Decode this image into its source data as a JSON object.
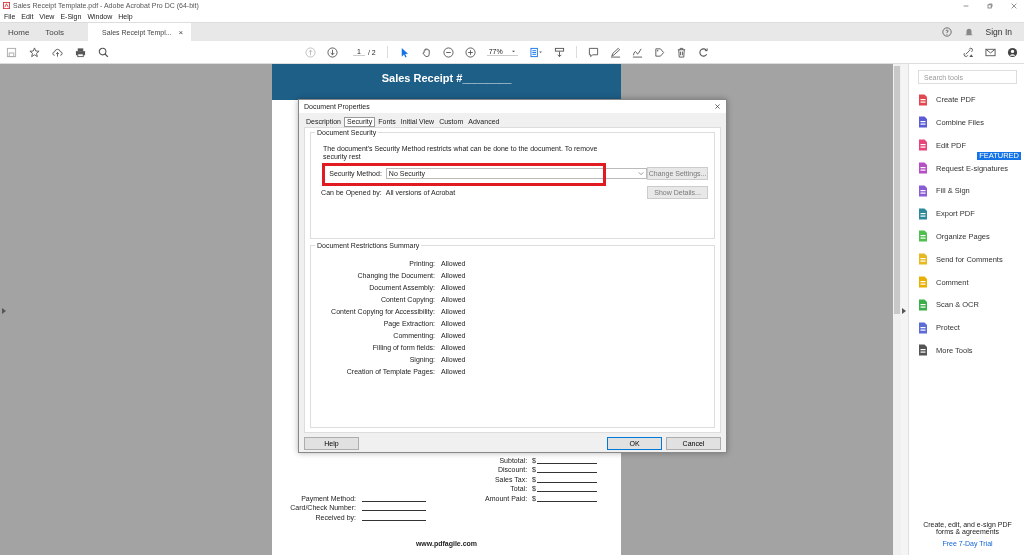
{
  "window": {
    "title": "Sales Receipt Template.pdf - Adobe Acrobat Pro DC (64-bit)"
  },
  "menu": [
    "File",
    "Edit",
    "View",
    "E-Sign",
    "Window",
    "Help"
  ],
  "nav_tabs": [
    {
      "label": "Home",
      "selected": false
    },
    {
      "label": "Tools",
      "selected": false
    },
    {
      "label": "Sales Receipt Templ...",
      "selected": true,
      "close": "×"
    }
  ],
  "sign_in": "Sign In",
  "toolbar": {
    "page_current": "1",
    "page_total": "/ 2",
    "zoom": "77%"
  },
  "document": {
    "title": "Sales Receipt #________",
    "totals": [
      {
        "label": "Subtotal:",
        "currency": "$"
      },
      {
        "label": "Discount:",
        "currency": "$"
      },
      {
        "label": "Sales Tax:",
        "currency": "$"
      },
      {
        "label": "Total:",
        "currency": "$"
      },
      {
        "label": "Amount Paid:",
        "currency": "$"
      }
    ],
    "payment": [
      {
        "label": "Payment Method:"
      },
      {
        "label": "Card/Check Number:"
      },
      {
        "label": "Received by:"
      }
    ],
    "footer": "www.pdfagile.com"
  },
  "dialog": {
    "title": "Document Properties",
    "tabs": [
      {
        "label": "Description",
        "selected": false
      },
      {
        "label": "Security",
        "selected": true
      },
      {
        "label": "Fonts",
        "selected": false
      },
      {
        "label": "Initial View",
        "selected": false
      },
      {
        "label": "Custom",
        "selected": false
      },
      {
        "label": "Advanced",
        "selected": false
      }
    ],
    "security_group": "Document Security",
    "description_lines": [
      "The document's Security Method restricts what can be done to the document. To remove",
      "security rest"
    ],
    "method_label": "Security Method:",
    "method_value": "No Security",
    "change_settings": {
      "label": "Change Settings...",
      "disabled": true
    },
    "opened_by_label": "Can be Opened by:",
    "opened_by_value": "All versions of Acrobat",
    "show_details": {
      "label": "Show Details...",
      "disabled": true
    },
    "summary_group": "Document Restrictions Summary",
    "restrictions": [
      {
        "name": "Printing:",
        "value": "Allowed"
      },
      {
        "name": "Changing the Document:",
        "value": "Allowed"
      },
      {
        "name": "Document Assembly:",
        "value": "Allowed"
      },
      {
        "name": "Content Copying:",
        "value": "Allowed"
      },
      {
        "name": "Content Copying for Accessibility:",
        "value": "Allowed"
      },
      {
        "name": "Page Extraction:",
        "value": "Allowed"
      },
      {
        "name": "Commenting:",
        "value": "Allowed"
      },
      {
        "name": "Filling of form fields:",
        "value": "Allowed"
      },
      {
        "name": "Signing:",
        "value": "Allowed"
      },
      {
        "name": "Creation of Template Pages:",
        "value": "Allowed"
      }
    ],
    "buttons": [
      {
        "label": "Help",
        "default": false
      },
      {
        "label": "OK",
        "default": true
      },
      {
        "label": "Cancel",
        "default": false
      }
    ]
  },
  "tools_panel": {
    "search": {
      "placeholder": "Search tools"
    },
    "items": [
      {
        "label": "Create PDF",
        "color": "#e34850"
      },
      {
        "label": "Combine Files",
        "color": "#5b5bd6"
      },
      {
        "label": "Edit PDF",
        "color": "#e8447a"
      },
      {
        "label": "Request E-signatures",
        "color": "#b44fc4",
        "badge": "FEATURED"
      },
      {
        "label": "Fill & Sign",
        "color": "#8a5cd6"
      },
      {
        "label": "Export PDF",
        "color": "#2d8a9a"
      },
      {
        "label": "Organize Pages",
        "color": "#4fbf4f"
      },
      {
        "label": "Send for Comments",
        "color": "#e8b820"
      },
      {
        "label": "Comment",
        "color": "#e8b000"
      },
      {
        "label": "Scan & OCR",
        "color": "#3ab04a"
      },
      {
        "label": "Protect",
        "color": "#5c6bd6"
      },
      {
        "label": "More Tools",
        "color": "#555555"
      }
    ],
    "footer_text": "Create, edit, and e-sign PDF forms & agreements",
    "trial_link": "Free 7-Day Trial"
  }
}
